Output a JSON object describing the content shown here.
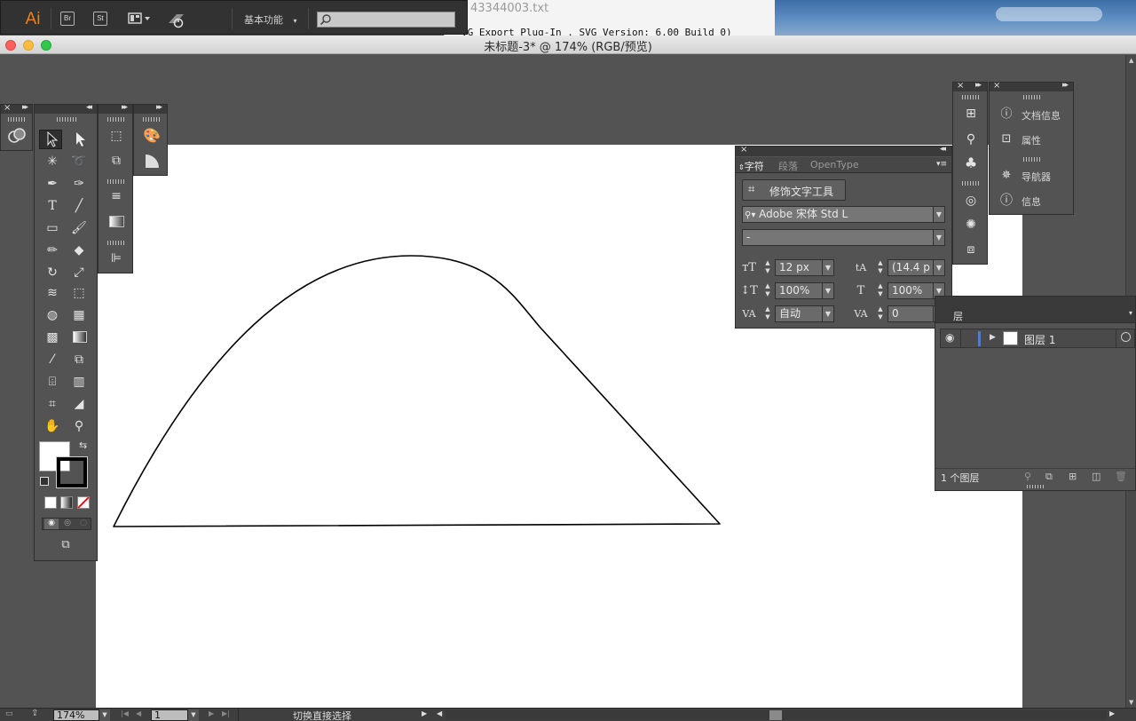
{
  "app": {
    "logo_text": "Ai",
    "bridge_btn": "Br",
    "stock_btn": "St",
    "workspace_label": "基本功能",
    "search_placeholder": ""
  },
  "background_window": {
    "title": "43344003.txt",
    "content": "VG Export Plug-In . SVG Version: 6.00 Build 0)"
  },
  "document": {
    "title": "未标题-3* @ 174% (RGB/预览)"
  },
  "right_dock": {
    "items": [
      {
        "label": "文档信息",
        "icon": "document-info-icon"
      },
      {
        "label": "属性",
        "icon": "attributes-icon"
      },
      {
        "label": "导航器",
        "icon": "navigator-icon"
      },
      {
        "label": "信息",
        "icon": "info-icon"
      }
    ]
  },
  "character_panel": {
    "tabs": [
      "字符",
      "段落",
      "OpenType"
    ],
    "touch_type_button": "修饰文字工具",
    "font_family": "Adobe 宋体 Std L",
    "font_style": "-",
    "font_size": "12 px",
    "leading": "(14.4 p",
    "vertical_scale": "100%",
    "horizontal_scale": "100%",
    "kerning": "自动",
    "tracking": "0"
  },
  "layers_panel": {
    "tab_label": "层",
    "layer_name": "图层 1",
    "layer_count": "1 个图层"
  },
  "status_bar": {
    "zoom": "174%",
    "artboard_number": "1",
    "status_text": "切换直接选择"
  },
  "colors": {
    "ui_dark": "#535353",
    "panel_header": "#3a3a3a",
    "accent_orange": "#ef7f1a",
    "layer_color": "#4f7ec9"
  }
}
